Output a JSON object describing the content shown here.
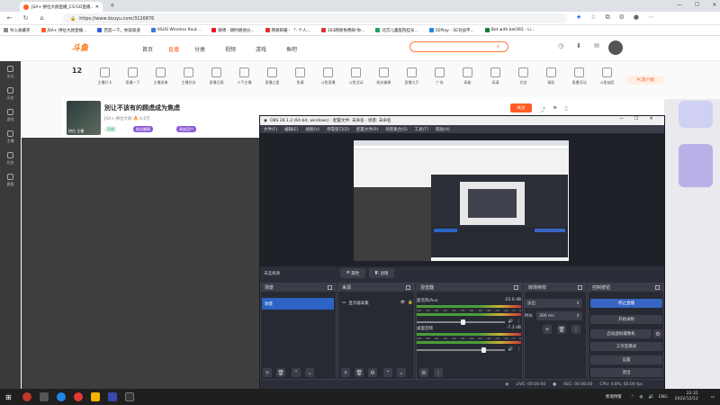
{
  "browser": {
    "tab_title": "JSA+ 拼位大颜直播_CS:GO直播...",
    "url": "https://www.douyu.com/3126876",
    "bookmarks": [
      {
        "label": "导入收藏夹",
        "color": "#888"
      },
      {
        "label": "JSA+ 拼位大颜直播...",
        "color": "#ff5d23"
      },
      {
        "label": "百度一下，你就知道",
        "color": "#2a5fd9"
      },
      {
        "label": "ASUS Wireless Rout...",
        "color": "#3b78d8"
      },
      {
        "label": "微博 - 随时随地分...",
        "color": "#e6162d"
      },
      {
        "label": "网易邮箱 - 「- 个人...",
        "color": "#d33"
      },
      {
        "label": "163网易免费邮-你...",
        "color": "#d33"
      },
      {
        "label": "北京儿童医院挂号...",
        "color": "#1aa260"
      },
      {
        "label": "5EPlay - 5E对战平...",
        "color": "#1e88e5"
      },
      {
        "label": "Bet with bet365 - Li...",
        "color": "#0e7c3a"
      }
    ]
  },
  "douyu": {
    "logo": "斗鱼",
    "nav": [
      "首页",
      "直播",
      "分类",
      "视频",
      "游戏",
      "鱼吧"
    ],
    "nav_active": 1,
    "pc_client": "PC客户端",
    "left_sidebar": [
      "关注",
      "历史",
      "游戏",
      "主播",
      "任务",
      "客服"
    ],
    "categories": [
      "主播打卡",
      "直播一下",
      "主播录像",
      "主播任务",
      "直播日报",
      "人气主播",
      "直播之星",
      "鱼塘",
      "斗鱼直播",
      "斗鱼活动",
      "粉丝徽章",
      "直播大厅",
      "广场",
      "高能",
      "高清",
      "任务",
      "精彩",
      "直播活动",
      "斗鱼抽奖"
    ],
    "follow_count": "12",
    "room": {
      "title": "別让不该有的顾虑成为焦虑",
      "streamer": "JSA+ 拼位大颜",
      "hot": "4.6万",
      "tags": [
        "直播",
        "粉丝徽章",
        "贵族用户"
      ],
      "follow_btn": "关注",
      "avatar_caption": "拼位  主播"
    }
  },
  "obs": {
    "title": "OBS 28.1.2 (64-bit, windows) - 配置文件: 未命名 - 场景: 未命名",
    "menu": [
      "文件(F)",
      "编辑(E)",
      "视图(V)",
      "停靠窗口(D)",
      "配置文件(P)",
      "场景集合(S)",
      "工具(T)",
      "帮助(H)"
    ],
    "no_source": "未选择源",
    "props_btn": "属性",
    "filter_btn": "滤镜",
    "docks": {
      "scenes": {
        "title": "场景",
        "items": [
          "场景"
        ]
      },
      "sources": {
        "title": "来源",
        "items": [
          "显示器采集"
        ]
      },
      "mixer": {
        "title": "混音器",
        "channels": [
          {
            "name": "麦克风/Aux",
            "db": "-25.0 dB",
            "level": 0.56
          },
          {
            "name": "桌面音频",
            "db": "-7.3 dB",
            "level": 0.82
          }
        ],
        "scale": [
          "-60",
          "-55",
          "-50",
          "-45",
          "-40",
          "-35",
          "-30",
          "-25",
          "-20",
          "-15",
          "-10",
          "-5",
          "0"
        ]
      },
      "transitions": {
        "title": "转场特效",
        "type": "淡出",
        "duration_label": "时长",
        "duration": "300 ms"
      },
      "controls": {
        "title": "控制按钮",
        "buttons": [
          "停止直播",
          "开始录制",
          "启动虚拟摄像机",
          "工作室模式",
          "设置",
          "退出"
        ]
      }
    },
    "status": {
      "live": "LIVE: 00:00:00",
      "rec": "REC: 00:00:00",
      "cpu": "CPU: 0.8%, 60.00 fps"
    }
  },
  "taskbar": {
    "weather": "寒潮预警",
    "lang": "ENG",
    "time": "22:31",
    "date": "2022/12/12"
  },
  "colors": {
    "accent": "#ff5d23",
    "obs_blue": "#3865c3",
    "obs_bg": "#2b2e38"
  }
}
